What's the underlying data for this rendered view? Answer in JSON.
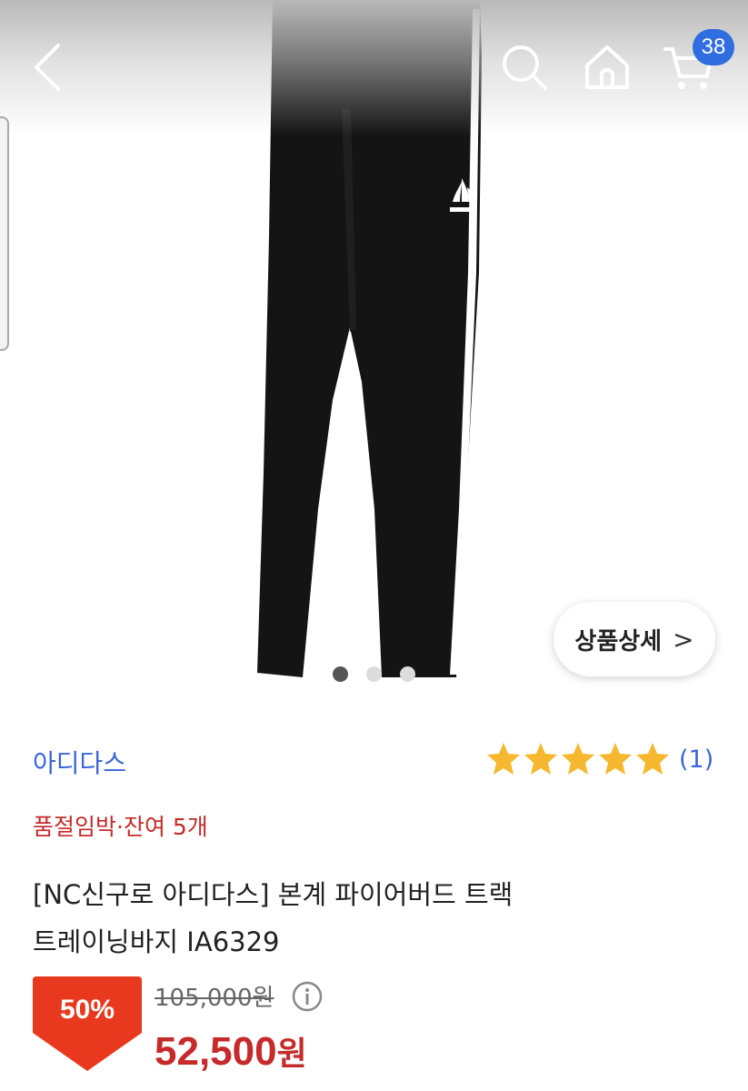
{
  "header": {
    "back_icon": "chevron-left-icon",
    "search_icon": "search-icon",
    "home_icon": "home-icon",
    "cart_icon": "cart-icon",
    "cart_count": "38"
  },
  "gallery": {
    "image_count": 3,
    "active_index": 0,
    "detail_button_label": "상품상세",
    "detail_button_chevron": ">"
  },
  "product": {
    "brand": "아디다스",
    "rating_stars": 5,
    "review_count": "(1)",
    "stock_notice": "품절임박·잔여 5개",
    "title_line1": "[NC신구로 아디다스] 본계 파이어버드 트랙",
    "title_line2": "트레이닝바지 IA6329",
    "discount_rate": "50%",
    "original_price": "105,000원",
    "sale_price": "52,500",
    "sale_currency": "원"
  },
  "colors": {
    "accent_blue": "#3a66d8",
    "sale_red": "#c62a2a",
    "badge_blue": "#2f6de0",
    "star_yellow": "#f5b82e"
  }
}
